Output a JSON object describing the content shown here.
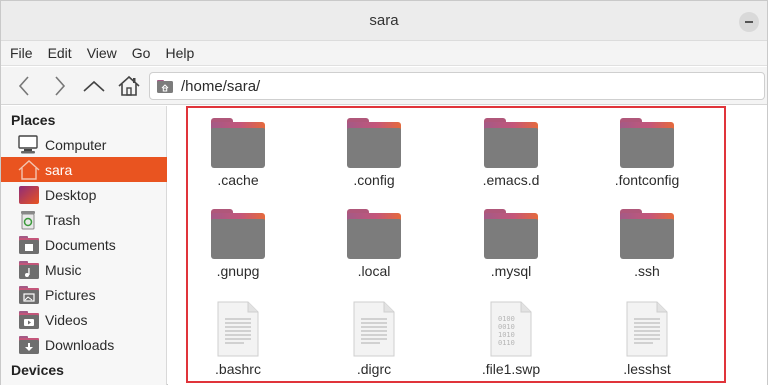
{
  "window": {
    "title": "sara"
  },
  "menu": [
    "File",
    "Edit",
    "View",
    "Go",
    "Help"
  ],
  "location": {
    "path": "/home/sara/"
  },
  "sidebar": {
    "places_title": "Places",
    "items": [
      {
        "label": "Computer",
        "icon": "computer-icon",
        "active": false
      },
      {
        "label": "sara",
        "icon": "home-icon",
        "active": true
      },
      {
        "label": "Desktop",
        "icon": "desktop-icon",
        "active": false
      },
      {
        "label": "Trash",
        "icon": "trash-icon",
        "active": false
      },
      {
        "label": "Documents",
        "icon": "documents-folder-icon",
        "active": false
      },
      {
        "label": "Music",
        "icon": "music-folder-icon",
        "active": false
      },
      {
        "label": "Pictures",
        "icon": "pictures-folder-icon",
        "active": false
      },
      {
        "label": "Videos",
        "icon": "videos-folder-icon",
        "active": false
      },
      {
        "label": "Downloads",
        "icon": "downloads-folder-icon",
        "active": false
      }
    ],
    "devices_title": "Devices"
  },
  "files": [
    {
      "name": ".cache",
      "type": "folder"
    },
    {
      "name": ".config",
      "type": "folder"
    },
    {
      "name": ".emacs.d",
      "type": "folder"
    },
    {
      "name": ".fontconfig",
      "type": "folder"
    },
    {
      "name": ".gnupg",
      "type": "folder"
    },
    {
      "name": ".local",
      "type": "folder"
    },
    {
      "name": ".mysql",
      "type": "folder"
    },
    {
      "name": ".ssh",
      "type": "folder"
    },
    {
      "name": ".bashrc",
      "type": "text"
    },
    {
      "name": ".digrc",
      "type": "text"
    },
    {
      "name": ".file1.swp",
      "type": "binary"
    },
    {
      "name": ".lesshst",
      "type": "text"
    }
  ],
  "colors": {
    "accent": "#e95420",
    "highlight_border": "#e0343a"
  }
}
